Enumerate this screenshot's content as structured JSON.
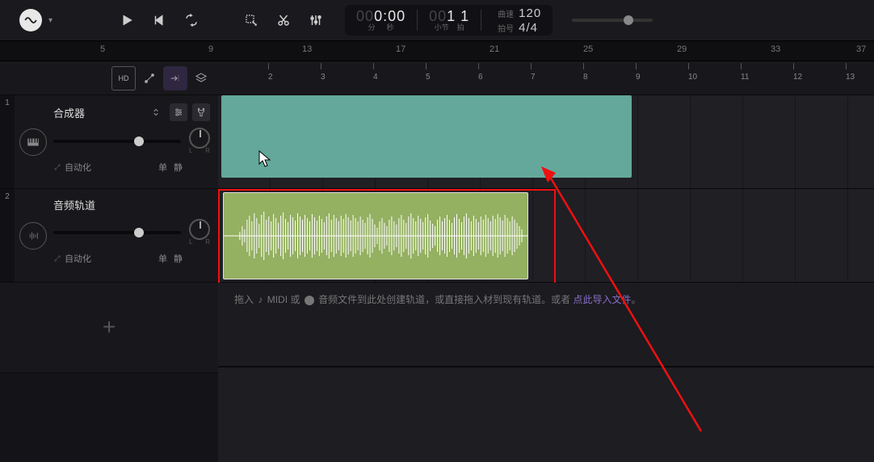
{
  "transport": {
    "time_prefix": "00",
    "time_main": "0:00",
    "time_unit_min": "分",
    "time_unit_sec": "秒",
    "bar_prefix": "00",
    "bar_main": "1  1",
    "bar_unit_bar": "小节",
    "bar_unit_beat": "拍",
    "tempo_label": "曲速",
    "tempo_value": "120",
    "sig_label": "拍号",
    "sig_value": "4/4"
  },
  "big_ruler": [
    "5",
    "9",
    "13",
    "17",
    "21",
    "25",
    "29",
    "33",
    "37"
  ],
  "timeline_ruler": [
    "2",
    "3",
    "4",
    "5",
    "6",
    "7",
    "8",
    "9",
    "10",
    "11",
    "12",
    "13"
  ],
  "left_toolbar": {
    "hd": "HD"
  },
  "tracks": [
    {
      "num": "1",
      "name": "合成器",
      "automation": "自动化",
      "solo": "单",
      "mute": "静",
      "pan_l": "L",
      "pan_r": "R"
    },
    {
      "num": "2",
      "name": "音频轨道",
      "automation": "自动化",
      "solo": "单",
      "mute": "静",
      "pan_l": "L",
      "pan_r": "R"
    }
  ],
  "hint": {
    "pre": "拖入",
    "midi": "MIDI 或",
    "mid": "音频文件到此处创建轨道，或直接拖入",
    "mid2": "材到现有轨道。或者",
    "link": "点此导入文件",
    "end": "。"
  }
}
